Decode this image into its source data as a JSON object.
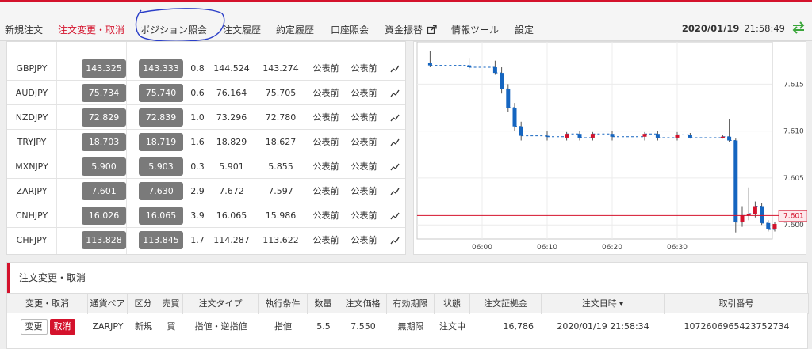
{
  "nav": {
    "items": [
      "新規注文",
      "注文変更・取消",
      "ポジション照会",
      "注文履歴",
      "約定履歴",
      "口座照会",
      "資金振替",
      "情報ツール",
      "設定"
    ],
    "active_index": 1,
    "date": "2020/01/19",
    "time": "21:58:49",
    "external_icon": "external-link-icon",
    "sync_icon": "sync-arrows-icon"
  },
  "rates": [
    {
      "pair": "GBPJPY",
      "bid": "143.325",
      "ask": "143.333",
      "spread": "0.8",
      "high": "144.524",
      "low": "143.274",
      "c1": "公表前",
      "c2": "公表前"
    },
    {
      "pair": "AUDJPY",
      "bid": "75.734",
      "ask": "75.740",
      "spread": "0.6",
      "high": "76.164",
      "low": "75.705",
      "c1": "公表前",
      "c2": "公表前"
    },
    {
      "pair": "NZDJPY",
      "bid": "72.829",
      "ask": "72.839",
      "spread": "1.0",
      "high": "73.296",
      "low": "72.780",
      "c1": "公表前",
      "c2": "公表前"
    },
    {
      "pair": "TRYJPY",
      "bid": "18.703",
      "ask": "18.719",
      "spread": "1.6",
      "high": "18.829",
      "low": "18.627",
      "c1": "公表前",
      "c2": "公表前"
    },
    {
      "pair": "MXNJPY",
      "bid": "5.900",
      "ask": "5.903",
      "spread": "0.3",
      "high": "5.901",
      "low": "5.855",
      "c1": "公表前",
      "c2": "公表前"
    },
    {
      "pair": "ZARJPY",
      "bid": "7.601",
      "ask": "7.630",
      "spread": "2.9",
      "high": "7.672",
      "low": "7.597",
      "c1": "公表前",
      "c2": "公表前"
    },
    {
      "pair": "CNHJPY",
      "bid": "16.026",
      "ask": "16.065",
      "spread": "3.9",
      "high": "16.065",
      "low": "15.986",
      "c1": "公表前",
      "c2": "公表前"
    },
    {
      "pair": "CHFJPY",
      "bid": "113.828",
      "ask": "113.845",
      "spread": "1.7",
      "high": "114.287",
      "low": "113.622",
      "c1": "公表前",
      "c2": "公表前"
    }
  ],
  "chart_data": {
    "type": "candlestick",
    "x_ticks": [
      "06:00",
      "06:10",
      "06:20",
      "06:30"
    ],
    "y_ticks": [
      "7.600",
      "7.605",
      "7.610",
      "7.615"
    ],
    "current_price_label": "7.601",
    "ylim": [
      7.5985,
      7.6195
    ],
    "up_color": "#d4122c",
    "down_color": "#1565c0",
    "candles": [
      {
        "t": -8,
        "o": 7.6173,
        "h": 7.6185,
        "l": 7.6168,
        "c": 7.617
      },
      {
        "t": -2,
        "o": 7.617,
        "h": 7.6178,
        "l": 7.6165,
        "c": 7.6168
      },
      {
        "t": 2,
        "o": 7.6168,
        "h": 7.6175,
        "l": 7.616,
        "c": 7.6162
      },
      {
        "t": 3,
        "o": 7.6162,
        "h": 7.6168,
        "l": 7.614,
        "c": 7.6145
      },
      {
        "t": 4,
        "o": 7.6145,
        "h": 7.615,
        "l": 7.612,
        "c": 7.6125
      },
      {
        "t": 5,
        "o": 7.6125,
        "h": 7.613,
        "l": 7.61,
        "c": 7.6105
      },
      {
        "t": 6,
        "o": 7.6105,
        "h": 7.611,
        "l": 7.609,
        "c": 7.6095
      },
      {
        "t": 10,
        "o": 7.6095,
        "h": 7.61,
        "l": 7.609,
        "c": 7.6094
      },
      {
        "t": 13,
        "o": 7.6093,
        "h": 7.6099,
        "l": 7.609,
        "c": 7.6097
      },
      {
        "t": 15,
        "o": 7.6097,
        "h": 7.61,
        "l": 7.609,
        "c": 7.6093
      },
      {
        "t": 17,
        "o": 7.6093,
        "h": 7.6099,
        "l": 7.609,
        "c": 7.6097
      },
      {
        "t": 20,
        "o": 7.6097,
        "h": 7.61,
        "l": 7.609,
        "c": 7.6094
      },
      {
        "t": 25,
        "o": 7.6094,
        "h": 7.6099,
        "l": 7.609,
        "c": 7.6097
      },
      {
        "t": 27,
        "o": 7.6097,
        "h": 7.61,
        "l": 7.609,
        "c": 7.6093
      },
      {
        "t": 30,
        "o": 7.6093,
        "h": 7.6099,
        "l": 7.609,
        "c": 7.6096
      },
      {
        "t": 32,
        "o": 7.6096,
        "h": 7.6098,
        "l": 7.6092,
        "c": 7.6093
      },
      {
        "t": 37,
        "o": 7.6093,
        "h": 7.6096,
        "l": 7.6092,
        "c": 7.6094
      },
      {
        "t": 38,
        "o": 7.6094,
        "h": 7.6113,
        "l": 7.6088,
        "c": 7.609
      },
      {
        "t": 39,
        "o": 7.609,
        "h": 7.6092,
        "l": 7.5992,
        "c": 7.6003
      },
      {
        "t": 40,
        "o": 7.6003,
        "h": 7.602,
        "l": 7.5998,
        "c": 7.601
      },
      {
        "t": 41,
        "o": 7.601,
        "h": 7.604,
        "l": 7.6005,
        "c": 7.6012
      },
      {
        "t": 42,
        "o": 7.6012,
        "h": 7.6025,
        "l": 7.6008,
        "c": 7.602
      },
      {
        "t": 43,
        "o": 7.602,
        "h": 7.6023,
        "l": 7.6,
        "c": 7.6002
      },
      {
        "t": 44,
        "o": 7.6002,
        "h": 7.6005,
        "l": 7.5993,
        "c": 7.5996
      },
      {
        "t": 45,
        "o": 7.5996,
        "h": 7.6003,
        "l": 7.5993,
        "c": 7.6001
      }
    ]
  },
  "order": {
    "section_title": "注文変更・取消",
    "headers": [
      "変更・取消",
      "通貨ペア",
      "区分",
      "売買",
      "注文タイプ",
      "執行条件",
      "数量",
      "注文価格",
      "有効期限",
      "状態",
      "注文証拠金",
      "注文日時",
      "取引番号"
    ],
    "sort_marker": "▾",
    "row": {
      "change_label": "変更",
      "cancel_label": "取消",
      "pair": "ZARJPY",
      "category": "新規",
      "side": "買",
      "order_type": "指値・逆指値",
      "condition": "指値",
      "quantity": "5.5",
      "price": "7.550",
      "expiry": "無期限",
      "status": "注文中",
      "margin": "16,786",
      "datetime": "2020/01/19 21:58:34",
      "trade_no": "1072606965423752734"
    }
  }
}
